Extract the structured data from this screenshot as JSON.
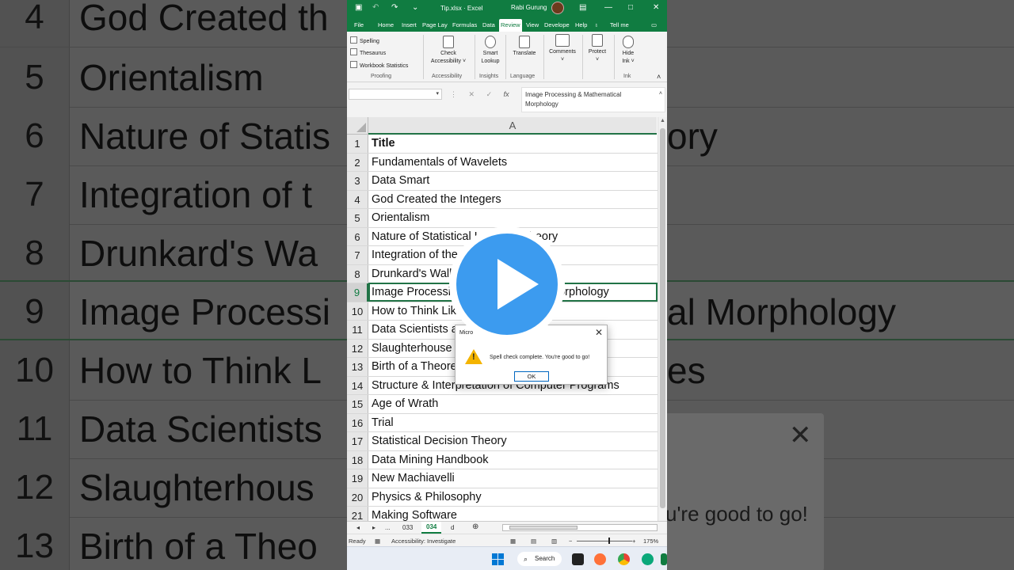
{
  "background": {
    "rows": [
      {
        "num": "4",
        "text": "God Created th"
      },
      {
        "num": "5",
        "text": "Orientalism"
      },
      {
        "num": "6",
        "text": "Nature of Statis",
        "tail": "ory"
      },
      {
        "num": "7",
        "text": "Integration of t"
      },
      {
        "num": "8",
        "text": "Drunkard's Wa"
      },
      {
        "num": "9",
        "text": "Image Processi",
        "tail": "al Morphology"
      },
      {
        "num": "10",
        "text": "How to Think L",
        "tail": "es"
      },
      {
        "num": "11",
        "text": "Data Scientists"
      },
      {
        "num": "12",
        "text": "Slaughterhous"
      },
      {
        "num": "13",
        "text": "Birth of a Theo"
      }
    ],
    "dialog_close": "✕",
    "dialog_text": "u're good to go!"
  },
  "titlebar": {
    "filename": "Tip.xlsx  ·  Excel",
    "user": "Rabi Gurung"
  },
  "tabs": [
    "File",
    "Home",
    "Insert",
    "Page Lay",
    "Formulas",
    "Data",
    "Review",
    "View",
    "Develope",
    "Help",
    "Tell me"
  ],
  "ribbon": {
    "proofing": [
      "Spelling",
      "Thesaurus",
      "Workbook Statistics"
    ],
    "check_accessibility": [
      "Check",
      "Accessibility ˅"
    ],
    "smart_lookup": [
      "Smart",
      "Lookup"
    ],
    "translate": "Translate",
    "comments": "Comments",
    "protect": "Protect",
    "hide_ink": [
      "Hide",
      "Ink ˅"
    ],
    "groups": [
      "Proofing",
      "Accessibility",
      "Insights",
      "Language",
      "Ink"
    ]
  },
  "formula_bar": {
    "fx": "fx",
    "content_line1": "Image Processing & Mathematical",
    "content_line2": "Morphology"
  },
  "grid": {
    "column": "A",
    "rows": [
      {
        "num": "1",
        "value": "Title"
      },
      {
        "num": "2",
        "value": "Fundamentals of Wavelets"
      },
      {
        "num": "3",
        "value": "Data Smart"
      },
      {
        "num": "4",
        "value": "God Created the Integers"
      },
      {
        "num": "5",
        "value": "Orientalism"
      },
      {
        "num": "6",
        "value": "Nature of Statistical Learning Theory"
      },
      {
        "num": "7",
        "value": "Integration of the Indian States"
      },
      {
        "num": "8",
        "value": "Drunkard's Walk, The"
      },
      {
        "num": "9",
        "value": "Image Processing & Mathematical Morphology"
      },
      {
        "num": "10",
        "value": "How to Think Like Sherlock Holmes"
      },
      {
        "num": "11",
        "value": "Data Scientists at Work"
      },
      {
        "num": "12",
        "value": "Slaughterhouse Five"
      },
      {
        "num": "13",
        "value": "Birth of a Theorem"
      },
      {
        "num": "14",
        "value": "Structure & Interpretation of Computer Programs"
      },
      {
        "num": "15",
        "value": "Age of Wrath"
      },
      {
        "num": "16",
        "value": "Trial"
      },
      {
        "num": "17",
        "value": "Statistical Decision Theory"
      },
      {
        "num": "18",
        "value": "Data Mining Handbook"
      },
      {
        "num": "19",
        "value": "New Machiavelli"
      },
      {
        "num": "20",
        "value": "Physics & Philosophy"
      },
      {
        "num": "21",
        "value": "Making Software"
      }
    ]
  },
  "sheets": {
    "prev": "◂",
    "next": "▸",
    "ellipsis": "...",
    "items": [
      "033",
      "034",
      "d"
    ],
    "add": "⊕"
  },
  "status": {
    "ready": "Ready",
    "accessibility": "Accessibility: Investigate",
    "zoom": "175%",
    "minus": "−",
    "plus": "+"
  },
  "taskbar": {
    "search": "Search"
  },
  "dialog": {
    "title": "Micro",
    "close": "✕",
    "message": "Spell check complete. You're good to go!",
    "ok": "OK"
  },
  "colors": {
    "excel_green": "#107c41",
    "play_blue": "#3c9bef",
    "warning": "#f4b400"
  }
}
